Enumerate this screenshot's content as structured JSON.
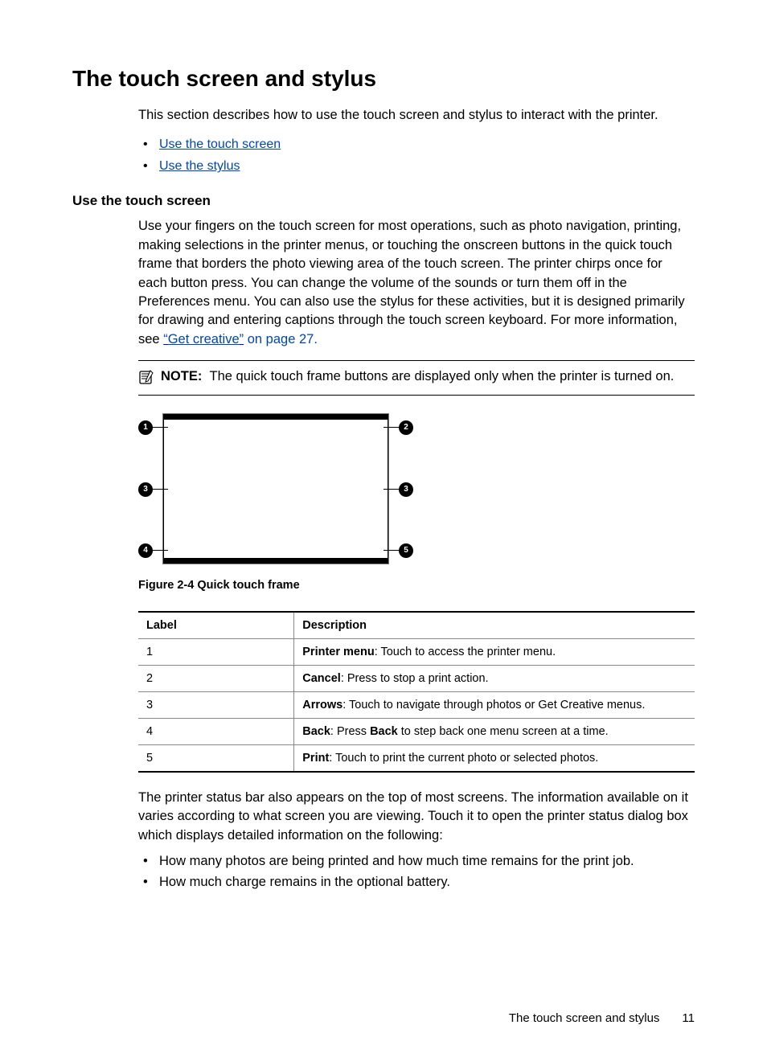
{
  "heading": "The touch screen and stylus",
  "intro": "This section describes how to use the touch screen and stylus to interact with the printer.",
  "links": {
    "touch_screen": "Use the touch screen",
    "stylus": "Use the stylus"
  },
  "section_heading": "Use the touch screen",
  "section_para_1": "Use your fingers on the touch screen for most operations, such as photo navigation, printing, making selections in the printer menus, or touching the onscreen buttons in the quick touch frame that borders the photo viewing area of the touch screen. The printer chirps once for each button press. You can change the volume of the sounds or turn them off in the Preferences menu. You can also use the stylus for these activities, but it is designed primarily for drawing and entering captions through the touch screen keyboard. For more information, see ",
  "section_para_1_link": "“Get creative”",
  "section_para_1_tail": " on page 27.",
  "note_label": "NOTE:",
  "note_text": "The quick touch frame buttons are displayed only when the printer is turned on.",
  "figure_caption": "Figure 2-4 Quick touch frame",
  "callouts": {
    "c1": "1",
    "c2": "2",
    "c3": "3",
    "c4": "4",
    "c5": "5"
  },
  "table": {
    "header_label": "Label",
    "header_desc": "Description",
    "rows": [
      {
        "label": "1",
        "bold": "Printer menu",
        "rest": ": Touch to access the printer menu."
      },
      {
        "label": "2",
        "bold": "Cancel",
        "rest": ": Press to stop a print action."
      },
      {
        "label": "3",
        "bold": "Arrows",
        "rest": ": Touch to navigate through photos or Get Creative menus."
      },
      {
        "label": "4",
        "bold": "Back",
        "rest_prefix": ": Press ",
        "bold2": "Back",
        "rest_suffix": " to step back one menu screen at a time."
      },
      {
        "label": "5",
        "bold": "Print",
        "rest": ": Touch to print the current photo or selected photos."
      }
    ]
  },
  "closing_para": "The printer status bar also appears on the top of most screens. The information available on it varies according to what screen you are viewing. Touch it to open the printer status dialog box which displays detailed information on the following:",
  "closing_bullets": [
    "How many photos are being printed and how much time remains for the print job.",
    "How much charge remains in the optional battery."
  ],
  "footer_text": "The touch screen and stylus",
  "footer_page": "11"
}
